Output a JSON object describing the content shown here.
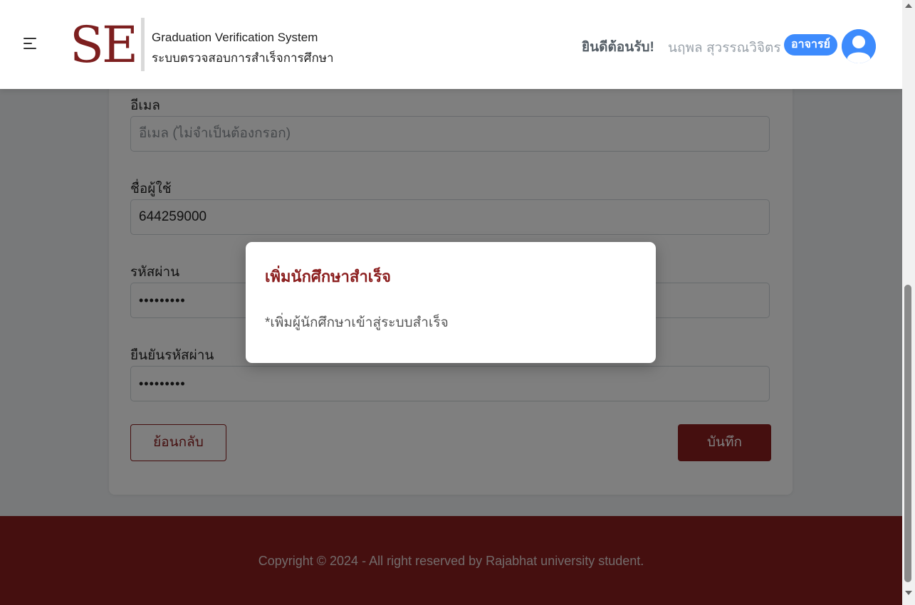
{
  "header": {
    "logo_text": "SE",
    "system_name_en": "Graduation Verification System",
    "system_name_th": "ระบบตรวจสอบการสำเร็จการศึกษา",
    "welcome": "ยินดีต้อนรับ!",
    "user_name": "นฤพล สุวรรณวิจิตร",
    "role": "อาจารย์",
    "menu_icon": "hamburger-menu-icon",
    "avatar_icon": "user-avatar-icon"
  },
  "form": {
    "email_label": "อีเมล",
    "email_placeholder": "อีเมล (ไม่จำเป็นต้องกรอก)",
    "username_label": "ชื่อผู้ใช้",
    "username_value": "644259000",
    "password_label": "รหัสผ่าน",
    "password_value": "•••••••••",
    "confirm_label": "ยืนยันรหัสผ่าน",
    "confirm_value": "•••••••••",
    "back_button": "ย้อนกลับ",
    "save_button": "บันทึก"
  },
  "modal": {
    "title": "เพิ่มนักศึกษาสำเร็จ",
    "message": "*เพิ่มผู้นักศึกษาเข้าสู่ระบบสำเร็จ"
  },
  "footer": {
    "copyright": "Copyright © 2024 - All right reserved by Rajabhat university student."
  },
  "colors": {
    "primary": "#8b1e1e",
    "badge": "#3d8bfd",
    "footer_bg": "#8b1f1f"
  }
}
